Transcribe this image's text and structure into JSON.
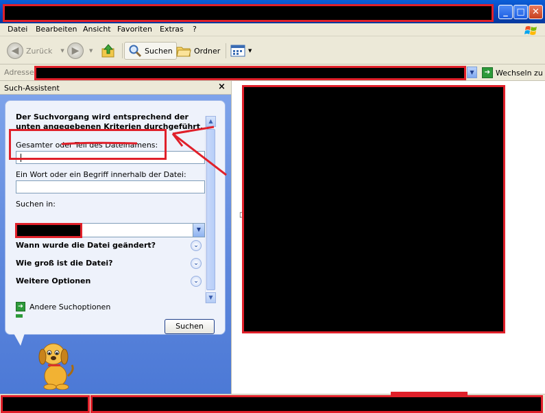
{
  "window": {
    "title": "",
    "controls": {
      "minimize": "_",
      "maximize": "□",
      "close": "✕"
    }
  },
  "menu": {
    "items": [
      "Datei",
      "Bearbeiten",
      "Ansicht",
      "Favoriten",
      "Extras",
      "?"
    ]
  },
  "toolbar": {
    "back_label": "Zurück",
    "forward_icon": "forward-arrow-icon",
    "up_icon": "folder-up-icon",
    "search_label": "Suchen",
    "folders_label": "Ordner",
    "views_icon": "views-icon"
  },
  "address": {
    "label": "Adresse",
    "value": "",
    "go_label": "Wechseln zu"
  },
  "side_panel": {
    "title": "Such-Assistent",
    "close": "×",
    "heading": "Der Suchvorgang wird entsprechend der unten angegebenen Kriterien durchgeführt.",
    "filename_label": "Gesamter oder Teil des Dateinamens:",
    "filename_value": "",
    "content_label": "Ein Wort oder ein Begriff innerhalb der Datei:",
    "content_value": "",
    "look_in_label": "Suchen in:",
    "look_in_value": "",
    "expanders": [
      "Wann wurde die Datei geändert?",
      "Wie groß ist die Datei?",
      "Weitere Optionen"
    ],
    "other_options": "Andere Suchoptionen",
    "search_button": "Suchen"
  },
  "colors": {
    "title_blue": "#0843b8",
    "panel_blue": "#5c86dc",
    "annotation_red": "#e0202a",
    "chrome": "#ece9d8"
  }
}
